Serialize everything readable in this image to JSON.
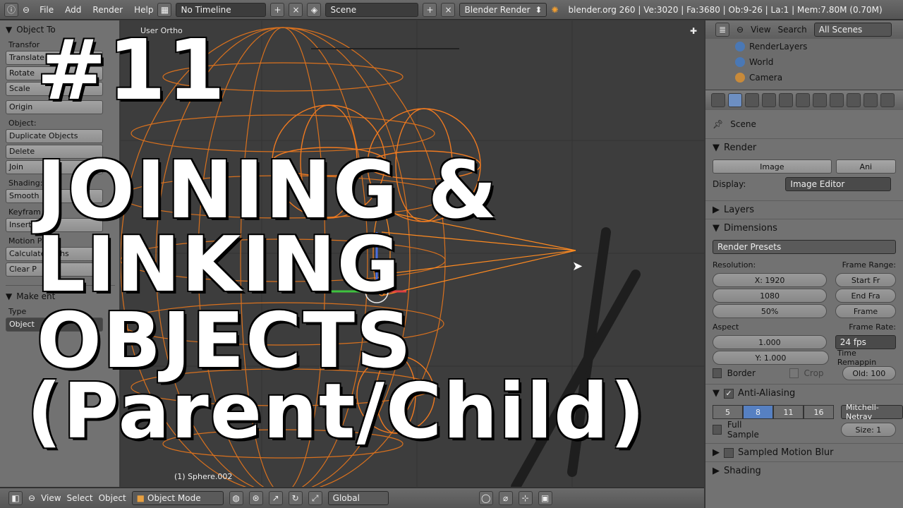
{
  "topbar": {
    "menus": [
      "File",
      "Add",
      "Render",
      "Help"
    ],
    "timeline": "No Timeline",
    "scene": "Scene",
    "engine": "Blender Render",
    "stats": "blender.org 260 | Ve:3020 | Fa:3680 | Ob:9-26 | La:1 | Mem:7.80M (0.70M)"
  },
  "toolshelf": {
    "title": "Object To",
    "transform_label": "Transfor",
    "translate": "Translate",
    "rotate": "Rotate",
    "scale": "Scale",
    "origin": "Origin",
    "object_label": "Object:",
    "duplicate": "Duplicate Objects",
    "delete": "Delete",
    "join": "Join",
    "shading_label": "Shading:",
    "smooth": "Smooth",
    "keyframes_label": "Keyfram",
    "insert": "Insert",
    "motion_label": "Motion Paths:",
    "calculate": "Calculate Paths",
    "clear": "Clear P",
    "make_parent": "Make   ent",
    "type_label": "Type",
    "type_value": "Object"
  },
  "viewport": {
    "view_label": "User Ortho",
    "object_name": "(1) Sphere.002"
  },
  "outliner": {
    "view": "View",
    "search": "Search",
    "filter": "All Scenes",
    "items": [
      "RenderLayers",
      "World",
      "Camera"
    ]
  },
  "props": {
    "scene_label": "Scene",
    "render_title": "Render",
    "image_btn": "Image",
    "anim_btn": "Ani",
    "display_label": "Display:",
    "display_value": "Image Editor",
    "layers": "Layers",
    "dimensions": "Dimensions",
    "presets": "Render Presets",
    "resolution_label": "Resolution:",
    "frame_range_label": "Frame Range:",
    "res_x": "X: 1920",
    "res_y": "1080",
    "res_pct": "50%",
    "start": "Start Fr",
    "end": "End Fra",
    "frame": "Frame",
    "aspect_label": "Aspect",
    "aspect_x": "1.000",
    "aspect_y": "Y: 1.000",
    "frame_rate_label": "Frame Rate:",
    "fps": "24 fps",
    "time_remap_label": "Time Remappin",
    "old": "Old: 100",
    "border": "Border",
    "crop": "Crop",
    "aa_title": "Anti-Aliasing",
    "aa_values": [
      "5",
      "8",
      "11",
      "16"
    ],
    "aa_filter": "Mitchell-Netrav",
    "full_sample": "Full Sample",
    "size": "Size: 1",
    "motion_blur": "Sampled Motion Blur",
    "shading": "Shading"
  },
  "bottombar": {
    "view": "View",
    "select": "Select",
    "object": "Object",
    "mode": "Object Mode",
    "orientation": "Global"
  },
  "overlay": {
    "number": "#11",
    "line1": "JOINING &",
    "line2": "LINKING OBJECTS",
    "line3": "(Parent/Child)"
  }
}
